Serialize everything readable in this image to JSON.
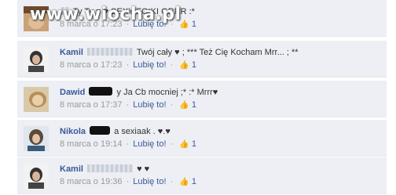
{
  "watermark": "www.wiocha.pl",
  "comments": [
    {
      "author": "",
      "text": "Ty Ty ♥ ♥ SEXY FOtKI GRRR :*",
      "date": "8 marca o 17:23",
      "like_label": "Lubię to!",
      "likes": "1"
    },
    {
      "author": "Kamil",
      "text": "Twój cały ♥ ; *** Też Cię Kocham Mrr... ; **",
      "date": "8 marca o 17:23",
      "like_label": "Lubię to!",
      "likes": "1"
    },
    {
      "author": "Dawid",
      "text": "y Ja Cb mocniej ;* :* Mrrr♥",
      "date": "8 marca o 17:37",
      "like_label": "Lubię to!",
      "likes": "1"
    },
    {
      "author": "Nikola",
      "text": "a sexiaak . ♥.♥",
      "date": "8 marca o 19:14",
      "like_label": "Lubię to!",
      "likes": "1"
    },
    {
      "author": "Kamil",
      "text": "♥ ♥",
      "date": "8 marca o 19:36",
      "like_label": "Lubię to!",
      "likes": "1"
    }
  ]
}
